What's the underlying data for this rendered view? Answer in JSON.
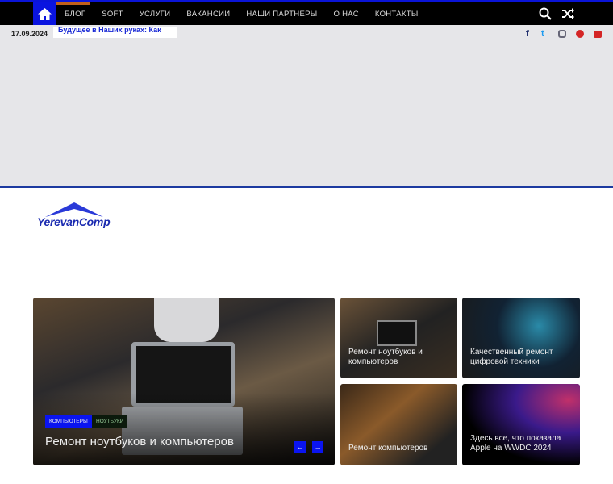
{
  "nav": {
    "items": [
      "БЛОГ",
      "SOFT",
      "УСЛУГИ",
      "ВАКАНСИИ",
      "НАШИ ПАРТНЕРЫ",
      "О НАС",
      "КОНТАКТЫ"
    ]
  },
  "topbar": {
    "date": "17.09.2024",
    "ticker": "Будущее в Наших руках: Как"
  },
  "social": [
    "facebook",
    "twitter",
    "instagram",
    "pinterest",
    "youtube"
  ],
  "logo": "YerevanComp",
  "featured": {
    "title": "Ремонт ноутбуков и компьютеров",
    "tags": [
      "КОМПЬЮТЕРЫ",
      "НОУТБУКИ"
    ]
  },
  "tiles": [
    {
      "title": "Ремонт ноутбуков и компьютеров"
    },
    {
      "title": "Качественный ремонт цифровой техники"
    },
    {
      "title": "Ремонт компьютеров"
    },
    {
      "title": "Здесь все, что показала Apple на WWDC 2024"
    }
  ],
  "colors": {
    "accent": "#0a14e0",
    "nav": "#000000"
  }
}
